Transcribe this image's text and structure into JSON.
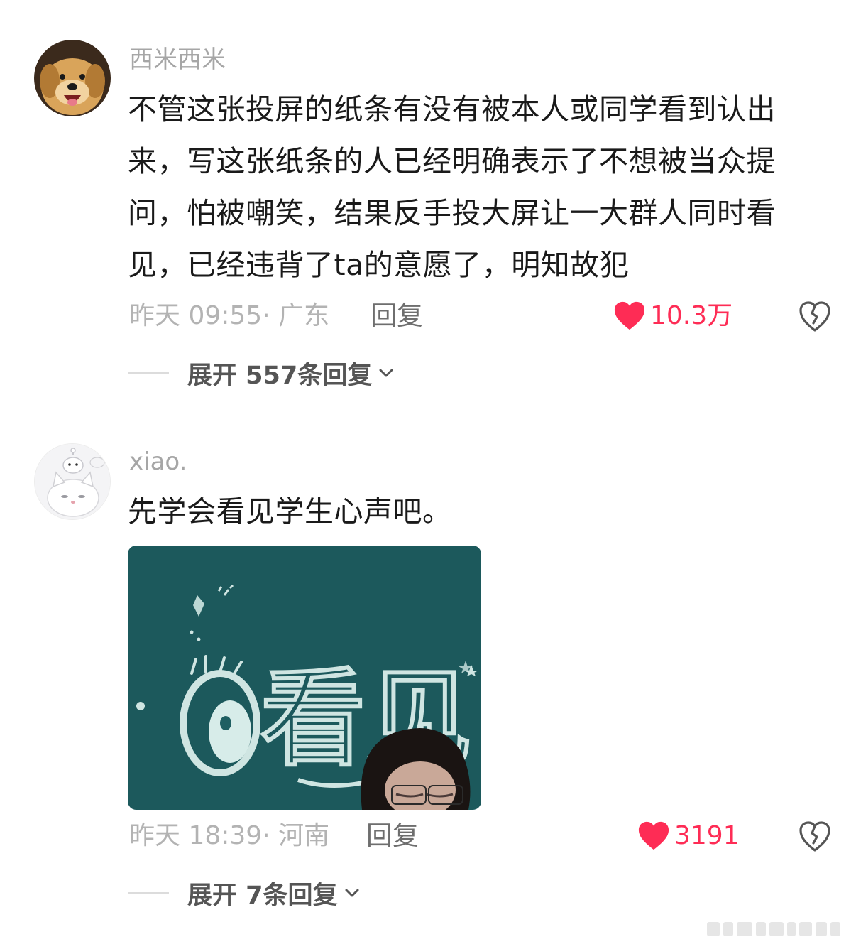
{
  "comments": [
    {
      "username": "西米西米",
      "content": "不管这张投屏的纸条有没有被本人或同学看到认出来，写这张纸条的人已经明确表示了不想被当众提问，怕被嘲笑，结果反手投大屏让一大群人同时看见，已经违背了ta的意愿了，明知故犯",
      "time_location": "昨天 09:55· 广东",
      "reply_label": "回复",
      "likes": "10.3万",
      "expand_label": "展开 557条回复",
      "avatar_icon": "dog-avatar"
    },
    {
      "username": "xiao.",
      "content": "先学会看见学生心声吧。",
      "time_location": "昨天 18:39· 河南",
      "reply_label": "回复",
      "likes": "3191",
      "expand_label": "展开 7条回复",
      "avatar_icon": "cat-avatar",
      "image_text": "看见"
    }
  ],
  "colors": {
    "like_red": "#fe2c55",
    "meta_gray": "#b3b3b3",
    "chalkboard": "#1f5f62"
  }
}
